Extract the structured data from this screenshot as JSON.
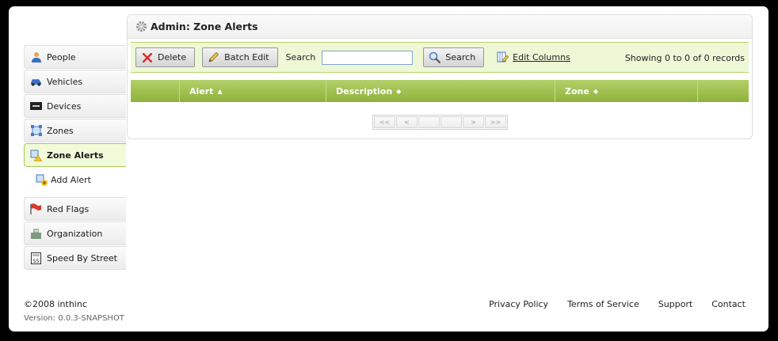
{
  "sidebar": {
    "items": [
      {
        "label": "People",
        "icon": "person-icon"
      },
      {
        "label": "Vehicles",
        "icon": "car-icon"
      },
      {
        "label": "Devices",
        "icon": "device-icon"
      },
      {
        "label": "Zones",
        "icon": "zone-icon"
      },
      {
        "label": "Zone Alerts",
        "icon": "zone-alert-icon",
        "active": true
      },
      {
        "label": "Add Alert",
        "icon": "add-alert-icon",
        "sub": true
      },
      {
        "label": "Red Flags",
        "icon": "red-flag-icon"
      },
      {
        "label": "Organization",
        "icon": "building-icon"
      },
      {
        "label": "Speed By Street",
        "icon": "speed-sign-icon"
      }
    ]
  },
  "panel": {
    "title": "Admin: Zone Alerts",
    "icon": "gear-icon"
  },
  "toolbar": {
    "delete_label": "Delete",
    "batch_edit_label": "Batch Edit",
    "search_label": "Search",
    "search_value": "",
    "search_button_label": "Search",
    "edit_columns_label": "Edit Columns",
    "records_text": "Showing 0 to 0 of 0 records"
  },
  "grid": {
    "columns": [
      {
        "label": "",
        "sort": ""
      },
      {
        "label": "Alert",
        "sort": "▲"
      },
      {
        "label": "Description",
        "sort": "◆"
      },
      {
        "label": "Zone",
        "sort": "◆"
      },
      {
        "label": "",
        "sort": ""
      }
    ]
  },
  "pager": [
    "<<",
    "<",
    "",
    "",
    ">",
    ">>"
  ],
  "footer": {
    "copyright": "©2008 inthinc",
    "version": "Version: 0.0.3-SNAPSHOT",
    "links": [
      "Privacy Policy",
      "Terms of Service",
      "Support",
      "Contact"
    ]
  },
  "colors": {
    "accent_green": "#9bbd48",
    "toolbar_bg": "#eef7d6",
    "active_nav_bg": "#f1fbd9"
  }
}
